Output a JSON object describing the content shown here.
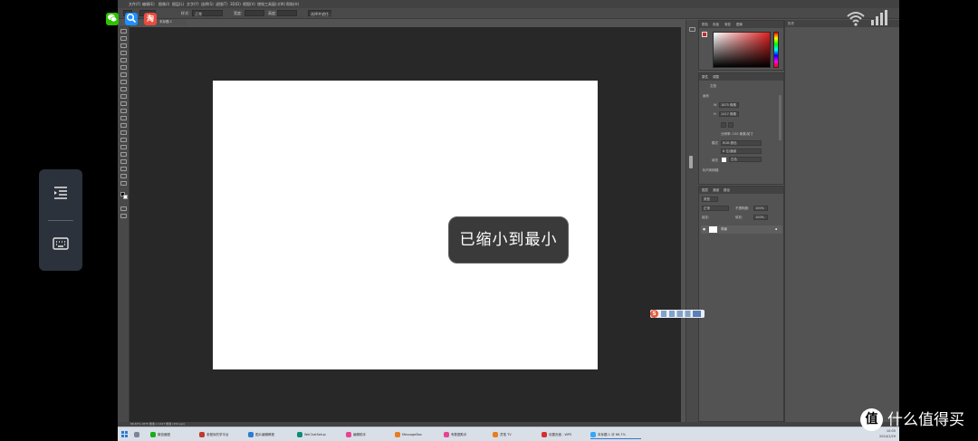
{
  "menubar": {
    "items": [
      "文件(F)",
      "编辑(E)",
      "图像(I)",
      "图层(L)",
      "文字(Y)",
      "选择(S)",
      "滤镜(T)",
      "3D(D)",
      "视图(V)",
      "增效工具",
      "窗口(W)",
      "帮助(H)"
    ]
  },
  "options_bar": {
    "style_label": "样式:",
    "style_value": "正常",
    "width_label": "宽度:",
    "height_label": "高度:",
    "select_and_mask": "选择并遮住..."
  },
  "document_tab": "未标题-1",
  "canvas_toast": "已缩小到最小",
  "color_panel": {
    "tabs": [
      "颜色",
      "色板",
      "渐变",
      "图案"
    ]
  },
  "properties_panel": {
    "tabs": [
      "属性",
      "调整"
    ],
    "title": "文档",
    "canvas_section": "画布",
    "width_label": "W",
    "width_value": "1875 像素",
    "height_label": "H",
    "height_value": "1417 像素",
    "resolution": "分辨率: 150 像素/英寸",
    "mode_label": "模式",
    "mode_value": "RGB 颜色",
    "depth_value": "8 位/通道",
    "fill_label": "填充",
    "fill_value": "白色",
    "ruler_grid": "标尺和网格"
  },
  "layers_panel": {
    "tabs": [
      "图层",
      "通道",
      "路径"
    ],
    "kind_label": "类型",
    "blend_mode": "正常",
    "opacity_label": "不透明度:",
    "opacity_value": "100%",
    "lock_label": "锁定:",
    "fill_label": "填充:",
    "fill_value": "100%",
    "layer_name": "背景"
  },
  "far_panel": {
    "tabs": [
      "历史"
    ]
  },
  "status_bar": "66.67%   1875 像素 x 1417 像素 (150 ppi)",
  "taskbar": {
    "items": [
      {
        "label": "微信截图",
        "color": "#1aad19"
      },
      {
        "label": "老程序的学平台",
        "color": "#c0392b"
      },
      {
        "label": "图片编辑教程",
        "color": "#2b7cd3"
      },
      {
        "label": "WeChatSetup",
        "color": "#0d8c7a"
      },
      {
        "label": "编辑助手",
        "color": "#e84393"
      },
      {
        "label": "MessageBox",
        "color": "#e67e22"
      },
      {
        "label": "有数据助手",
        "color": "#e84393"
      },
      {
        "label": "灵笔 TV",
        "color": "#e67e22"
      },
      {
        "label": "设置页面 - WPS",
        "color": "#d63031"
      },
      {
        "label": "未标题-1 @ 66.7%",
        "color": "#31a8ff"
      }
    ],
    "clock_time": "10:05",
    "clock_date": "2024/1/29"
  },
  "overlay": {
    "watermark_logo": "值",
    "watermark_text": "什么值得买",
    "wechat_icon_color": "#2dc100",
    "search_icon_color": "#1e90ff",
    "shop_icon_color": "#e84c3d",
    "shop_icon_glyph": "淘"
  }
}
